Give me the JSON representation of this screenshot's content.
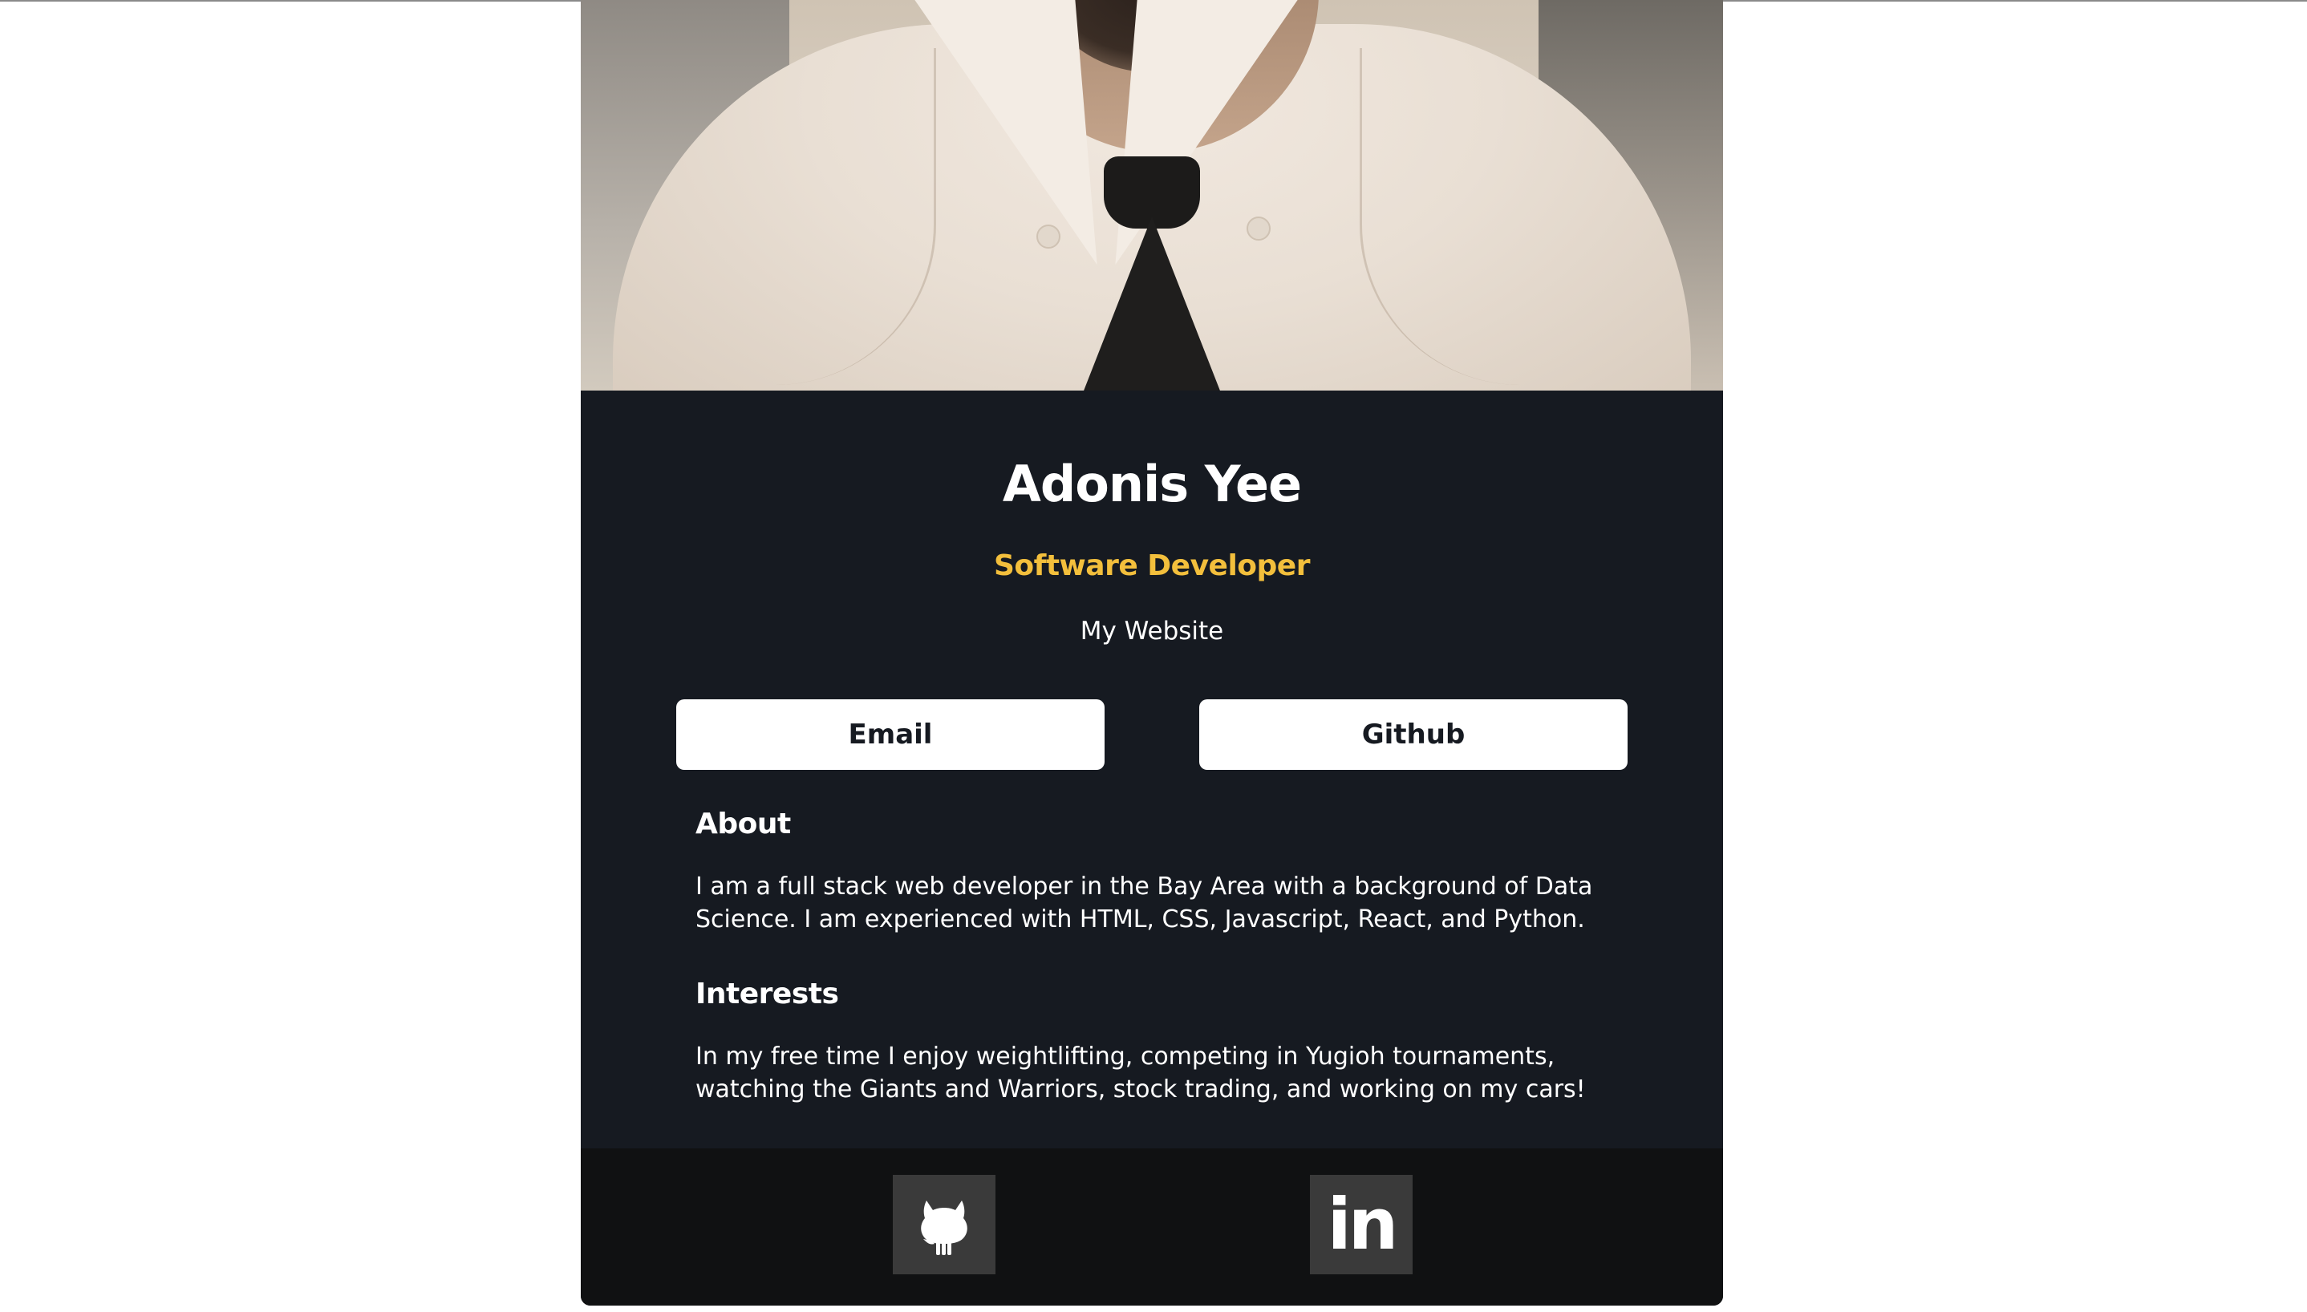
{
  "profile": {
    "name": "Adonis Yee",
    "role": "Software Developer",
    "website_label": "My Website"
  },
  "buttons": {
    "email_label": "Email",
    "github_label": "Github"
  },
  "about": {
    "heading": "About",
    "text": "I am a full stack web developer in the Bay Area with a background of Data Science. I am experienced with HTML, CSS, Javascript, React, and Python."
  },
  "interests": {
    "heading": "Interests",
    "text": "In my free time I enjoy weightlifting, competing in Yugioh tournaments, watching the Giants and Warriors, stock trading, and working on my cars!"
  },
  "footer": {
    "icons": [
      "github-icon",
      "linkedin-icon"
    ],
    "linkedin_glyph": "in"
  },
  "colors": {
    "card_bg": "#161a21",
    "footer_bg": "#101112",
    "accent": "#f3bf3c",
    "button_bg": "#ffffff",
    "social_bg": "#3a3a3a"
  }
}
